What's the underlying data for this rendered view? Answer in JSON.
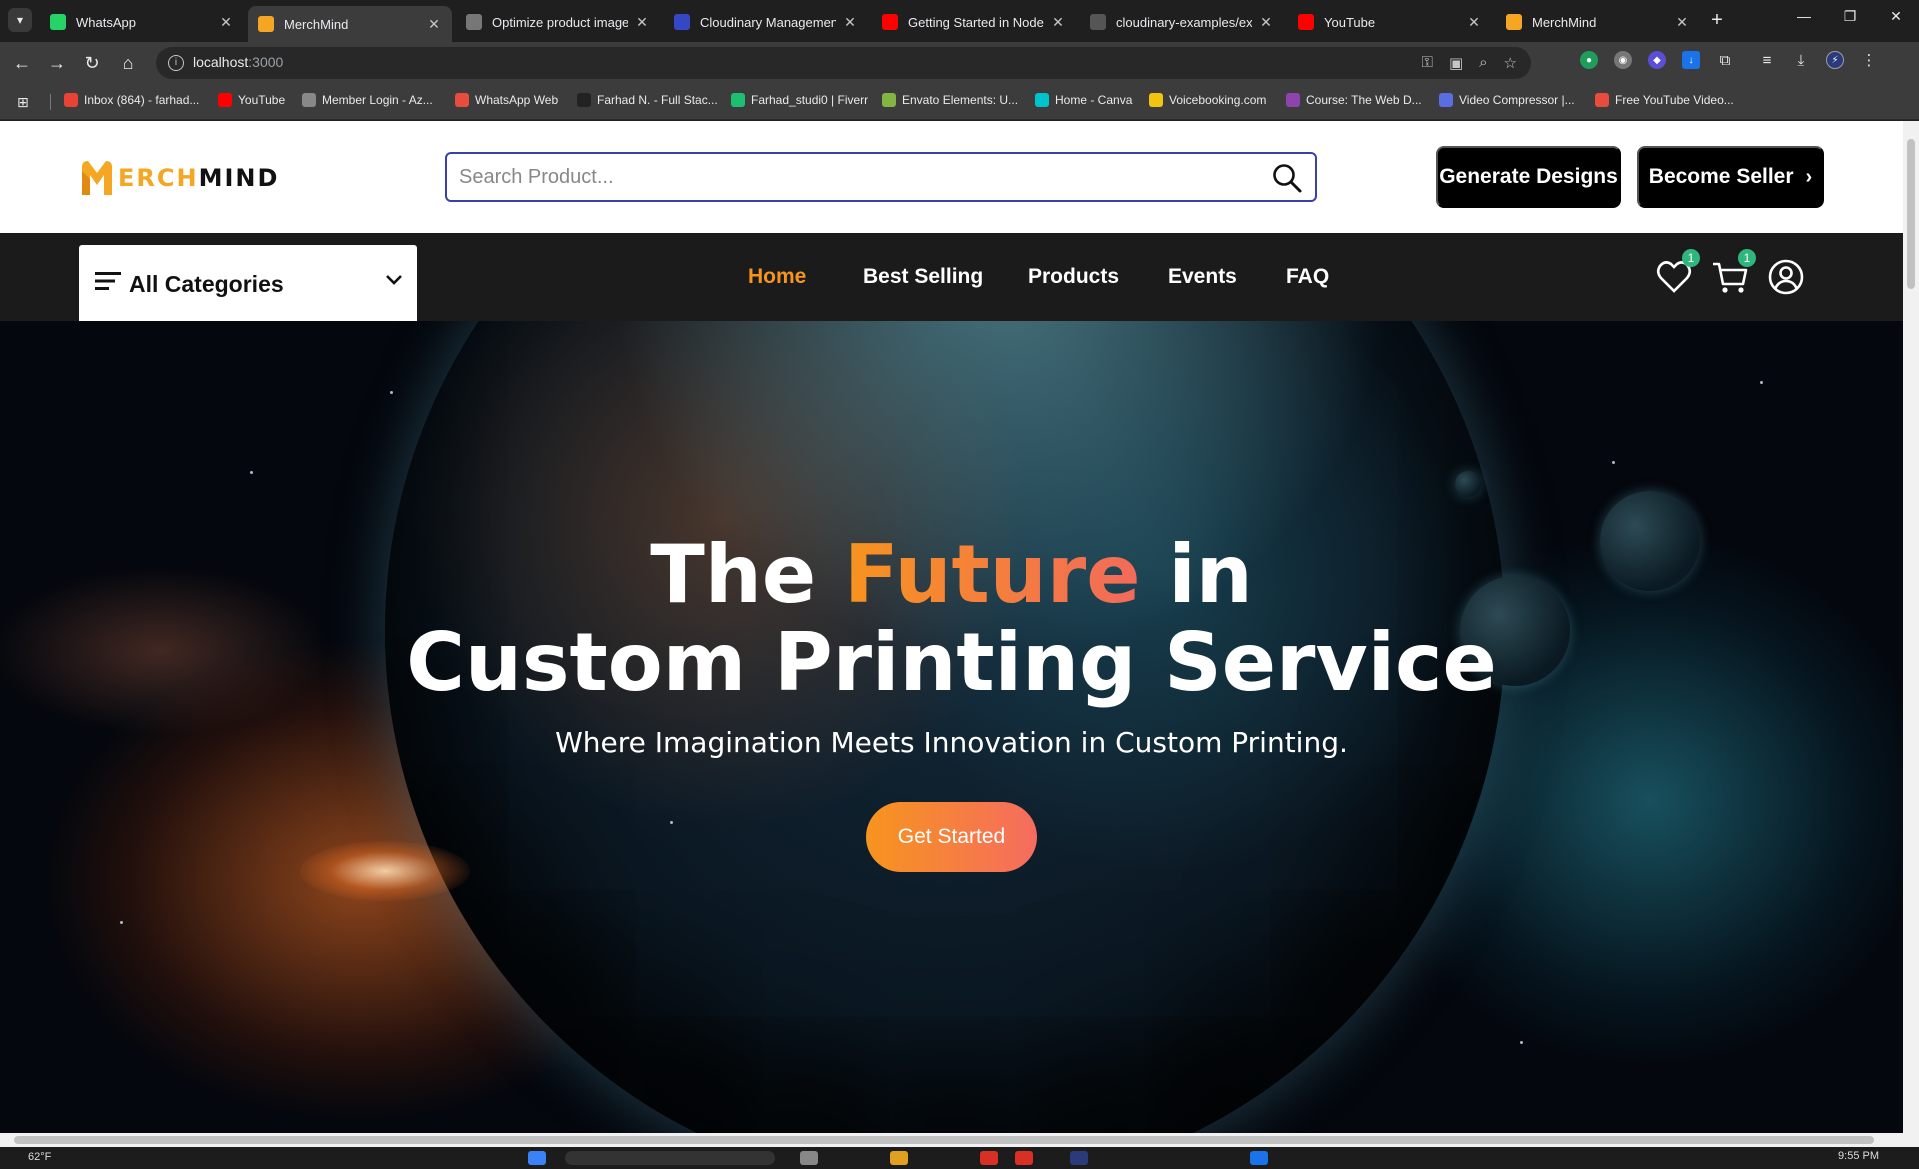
{
  "browser": {
    "tabs": [
      {
        "title": "WhatsApp",
        "icon": "whatsapp-icon",
        "color": "#25d366",
        "active": false
      },
      {
        "title": "MerchMind",
        "icon": "merchmind-icon",
        "color": "#f5a623",
        "active": true
      },
      {
        "title": "Optimize product image",
        "icon": "openai-icon",
        "color": "#777777",
        "active": false
      },
      {
        "title": "Cloudinary Management",
        "icon": "cloudinary-icon",
        "color": "#3448c5",
        "active": false
      },
      {
        "title": "Getting Started in Node.js",
        "icon": "youtube-icon",
        "color": "#ff0000",
        "active": false
      },
      {
        "title": "cloudinary-examples/exa",
        "icon": "github-icon",
        "color": "#555555",
        "active": false
      },
      {
        "title": "YouTube",
        "icon": "youtube-icon",
        "color": "#ff0000",
        "active": false
      },
      {
        "title": "MerchMind",
        "icon": "merchmind-icon",
        "color": "#f5a623",
        "active": false
      }
    ],
    "url_host": "localhost",
    "url_port": ":3000",
    "bookmarks": [
      {
        "label": "Inbox (864) - farhad...",
        "icon": "gmail-icon",
        "color": "#ea4335"
      },
      {
        "label": "YouTube",
        "icon": "youtube-icon",
        "color": "#ff0000"
      },
      {
        "label": "Member Login - Az...",
        "icon": "globe-icon",
        "color": "#888888"
      },
      {
        "label": "WhatsApp Web",
        "icon": "whatsapp-icon",
        "color": "#e74c3c"
      },
      {
        "label": "Farhad N. - Full Stac...",
        "icon": "upwork-icon",
        "color": "#222222"
      },
      {
        "label": "Farhad_studi0 | Fiverr",
        "icon": "fiverr-icon",
        "color": "#1dbf73"
      },
      {
        "label": "Envato Elements: U...",
        "icon": "envato-icon",
        "color": "#82b541"
      },
      {
        "label": "Home - Canva",
        "icon": "canva-icon",
        "color": "#00c4cc"
      },
      {
        "label": "Voicebooking.com",
        "icon": "voicebooking-icon",
        "color": "#f1c40f"
      },
      {
        "label": "Course: The Web D...",
        "icon": "course-icon",
        "color": "#8e44ad"
      },
      {
        "label": "Video Compressor |...",
        "icon": "compressor-icon",
        "color": "#5b6ee1"
      },
      {
        "label": "Free YouTube Video...",
        "icon": "download-icon",
        "color": "#e74c3c"
      }
    ]
  },
  "site": {
    "logo_part1": "ERCH",
    "logo_part2": "MIND",
    "search_placeholder": "Search Product...",
    "generate_label": "Generate Designs",
    "seller_label": "Become Seller",
    "categories_label": "All Categories",
    "nav": [
      "Home",
      "Best Selling",
      "Products",
      "Events",
      "FAQ"
    ],
    "wishlist_count": "1",
    "cart_count": "1",
    "accent_color": "#f7941e"
  },
  "hero": {
    "title_the": "The ",
    "title_future": "Future",
    "title_in": " in",
    "title_line2": "Custom Printing Service",
    "subtitle": "Where Imagination Meets Innovation in Custom Printing.",
    "cta_label": "Get Started"
  },
  "taskbar": {
    "weather": "62°F",
    "clock": "9:55 PM"
  }
}
